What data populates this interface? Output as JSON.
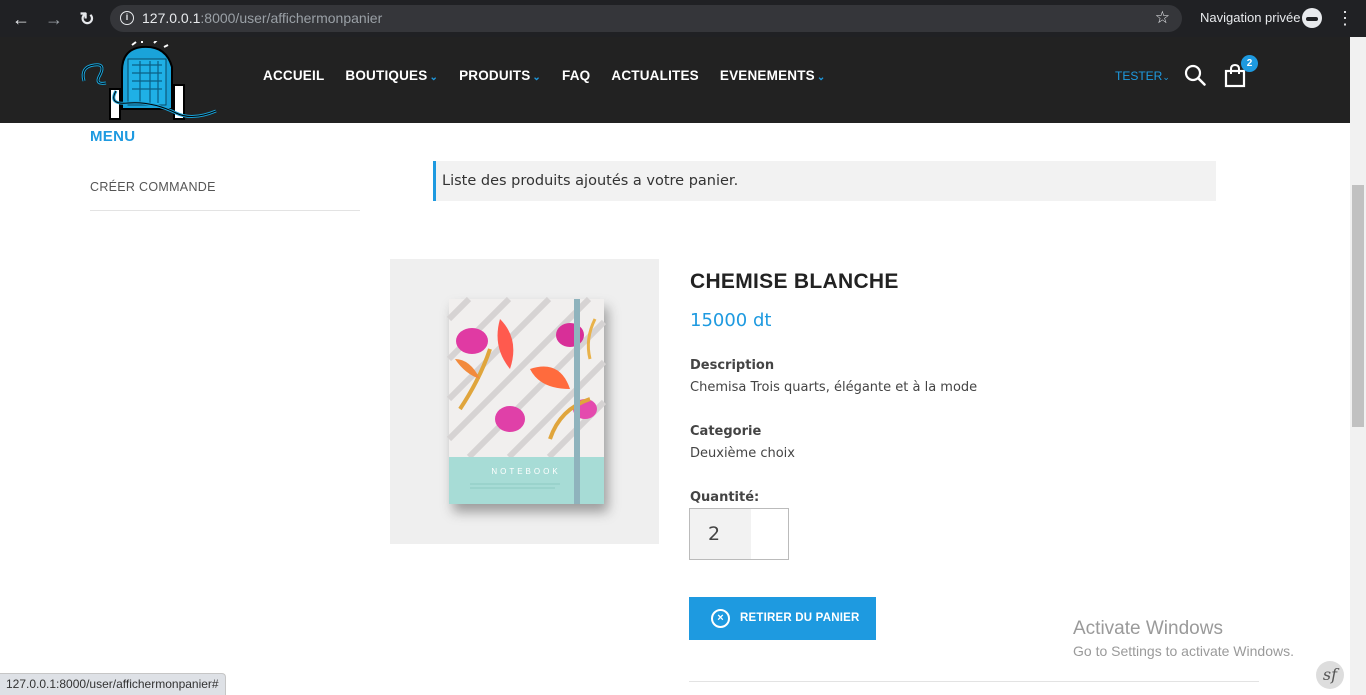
{
  "browser": {
    "url_host": "127.0.0.1",
    "url_path": ":8000/user/affichermonpanier",
    "private_label": "Navigation privée",
    "back_icon": "←",
    "forward_icon": "→",
    "reload_icon": "↻",
    "star_icon": "☆",
    "menu_icon": "⋮",
    "status_url": "127.0.0.1:8000/user/affichermonpanier#"
  },
  "header": {
    "logo_alt": "Souk Lemdina",
    "nav": [
      {
        "label": "ACCUEIL",
        "has_dropdown": false
      },
      {
        "label": "BOUTIQUES",
        "has_dropdown": true
      },
      {
        "label": "PRODUITS",
        "has_dropdown": true
      },
      {
        "label": "FAQ",
        "has_dropdown": false
      },
      {
        "label": "ACTUALITES",
        "has_dropdown": false
      },
      {
        "label": "EVENEMENTS",
        "has_dropdown": true
      }
    ],
    "user_label": "TESTER",
    "cart_count": "2",
    "accent_color": "#1e9ae0"
  },
  "sidebar": {
    "title": "MENU",
    "items": [
      {
        "label": "CRÉER COMMANDE"
      }
    ]
  },
  "notice": {
    "text": "Liste des produits ajoutés a votre panier."
  },
  "product": {
    "name": "CHEMISE BLANCHE",
    "price": "15000 dt",
    "description_label": "Description",
    "description": "Chemisa Trois quarts, élégante et à la mode",
    "category_label": "Categorie",
    "category": "Deuxième choix",
    "quantity_label": "Quantité:",
    "quantity": "2",
    "remove_label": "RETIRER DU PANIER",
    "image_text": "NOTEBOOK"
  },
  "watermark": {
    "title": "Activate Windows",
    "subtitle": "Go to Settings to activate Windows."
  },
  "debug_toolbar": {
    "icon_label": "sf"
  }
}
